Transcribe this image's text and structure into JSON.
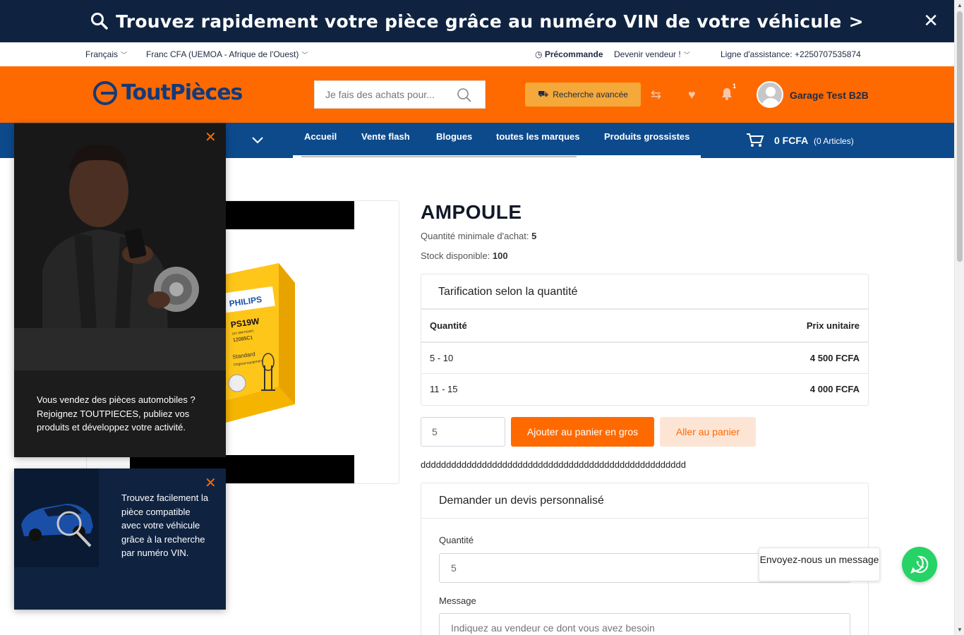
{
  "banner": {
    "text": "Trouvez rapidement votre pièce grâce au numéro VIN de votre véhicule",
    "arrow": ">",
    "close": "✕"
  },
  "utility": {
    "language": "Français",
    "currency": "Franc CFA (UEMOA - Afrique de l'Ouest)",
    "preorder": "Précommande",
    "become_seller": "Devenir vendeur !",
    "hotline": "Ligne d'assistance: +2250707535874"
  },
  "header": {
    "logo": "ToutPièces",
    "search_placeholder": "Je fais des achats pour...",
    "advanced_search": "Recherche avancée",
    "notifications_count": "1",
    "user_name": "Garage Test B2B"
  },
  "nav": {
    "items": [
      "Accueil",
      "Vente flash",
      "Blogues",
      "toutes les marques",
      "Produits grossistes"
    ],
    "cart_total": "0 FCFA",
    "cart_count": "(0 Articles)"
  },
  "product": {
    "title": "AMPOULE",
    "min_qty_label": "Quantité minimale d'achat:",
    "min_qty": "5",
    "stock_label": "Stock disponible:",
    "stock": "100",
    "package": {
      "brand": "PHILIPS",
      "model": "PS19W",
      "spec": "12V 19W PG20/1",
      "ref": "12085C1",
      "line": "Standard",
      "sub": "Original equipment"
    },
    "pricing": {
      "title": "Tarification selon la quantité",
      "col_qty": "Quantité",
      "col_price": "Prix unitaire",
      "rows": [
        {
          "qty": "5 - 10",
          "price": "4 500 FCFA"
        },
        {
          "qty": "11 - 15",
          "price": "4 000 FCFA"
        }
      ]
    },
    "qty_value": "5",
    "add_bulk": "Ajouter au panier en gros",
    "go_cart": "Aller au panier",
    "description": "dddddddddddddddddddddddddddddddddddddddddddddddddddd"
  },
  "quote": {
    "title": "Demander un devis personnalisé",
    "qty_label": "Quantité",
    "qty_value": "5",
    "message_label": "Message",
    "message_placeholder": "Indiquez au vendeur ce dont vous avez besoin"
  },
  "popups": {
    "seller_text": "Vous vendez des pièces automobiles ? Rejoignez TOUTPIECES, publiez vos produits et développez votre activité.",
    "vin_text": "Trouvez facilement la pièce compatible avec votre véhicule grâce à la recherche par numéro VIN.",
    "close": "✕"
  },
  "whatsapp": {
    "text": "Envoyez-nous un message"
  },
  "colors": {
    "orange": "#ff6a00",
    "navy": "#0f2341",
    "nav_blue": "#0d4a8c",
    "whatsapp": "#25d366"
  }
}
